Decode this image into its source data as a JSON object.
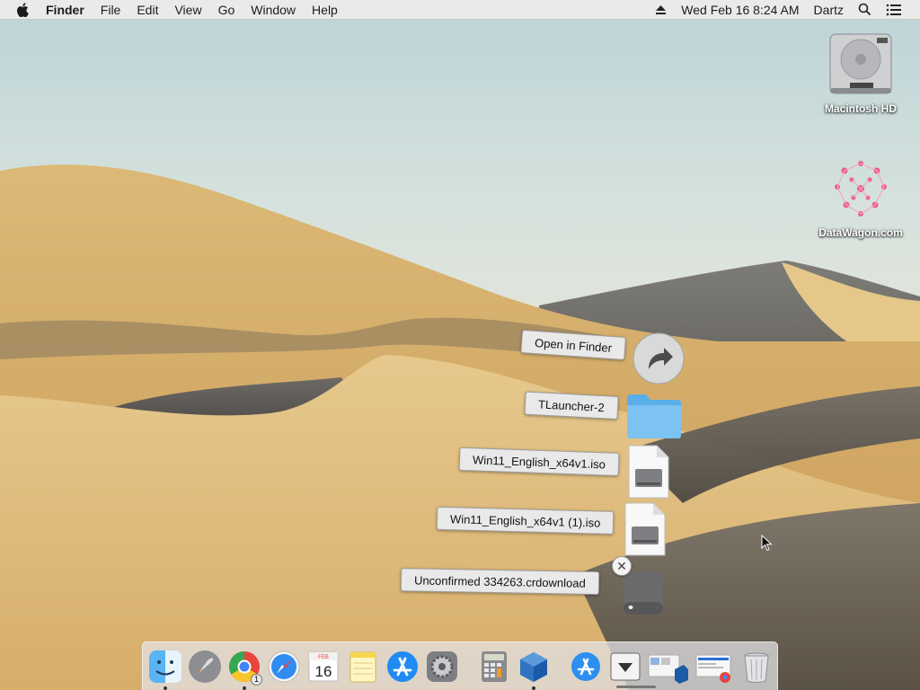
{
  "menubar": {
    "app": "Finder",
    "menus": [
      "File",
      "Edit",
      "View",
      "Go",
      "Window",
      "Help"
    ],
    "clock": "Wed Feb 16  8:24 AM",
    "user": "Dartz"
  },
  "desktop_icons": [
    {
      "label": "Macintosh HD",
      "icon": "hard-drive-icon"
    },
    {
      "label": "DataWagon.com",
      "icon": "pink-molecule-image"
    }
  ],
  "stack": {
    "open_in_finder": "Open in Finder",
    "items": [
      {
        "label": "TLauncher-2",
        "icon": "folder-icon"
      },
      {
        "label": "Win11_English_x64v1.iso",
        "icon": "disk-image-icon"
      },
      {
        "label": "Win11_English_x64v1 (1).iso",
        "icon": "disk-image-icon"
      },
      {
        "label": "Unconfirmed 334263.crdownload",
        "icon": "generic-disk-icon"
      }
    ]
  },
  "dock": {
    "items": [
      {
        "name": "finder",
        "running": true
      },
      {
        "name": "launchpad",
        "running": false
      },
      {
        "name": "chrome",
        "running": true,
        "badge": "1"
      },
      {
        "name": "safari",
        "running": false
      },
      {
        "name": "calendar",
        "running": false,
        "month": "FEB",
        "day": "16"
      },
      {
        "name": "notes",
        "running": false
      },
      {
        "name": "app-store",
        "running": false
      },
      {
        "name": "system-preferences",
        "running": false
      },
      {
        "name": "calculator",
        "running": false
      },
      {
        "name": "virtualbox",
        "running": true
      },
      {
        "name": "applications-folder",
        "running": false
      },
      {
        "name": "downloads-stack",
        "running": false
      },
      {
        "name": "window-thumbnail-1",
        "running": false
      },
      {
        "name": "window-thumbnail-2",
        "running": false
      },
      {
        "name": "trash",
        "running": false
      }
    ]
  }
}
